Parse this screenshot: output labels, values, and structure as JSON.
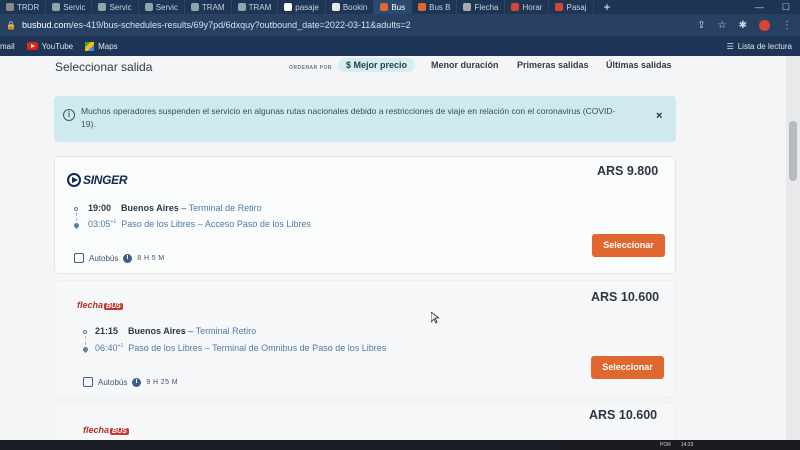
{
  "browser": {
    "tabs": [
      {
        "label": "TRDR",
        "color": "#888"
      },
      {
        "label": "Servic",
        "color": "#8aa"
      },
      {
        "label": "Servic",
        "color": "#8aa"
      },
      {
        "label": "Servic",
        "color": "#8aa"
      },
      {
        "label": "TRAM",
        "color": "#8aa"
      },
      {
        "label": "TRAM",
        "color": "#8aa"
      },
      {
        "label": "pasaje",
        "color": "#ffffff"
      },
      {
        "label": "Bookin",
        "color": "#e7e7e7"
      },
      {
        "label": "Bus",
        "color": "#e0672f"
      },
      {
        "label": "Bus B",
        "color": "#e0672f"
      },
      {
        "label": "Flecha",
        "color": "#aaa"
      },
      {
        "label": "Horar",
        "color": "#d64531"
      },
      {
        "label": "Pasaj",
        "color": "#d64531"
      }
    ],
    "url_host": "busbud.com",
    "url_path": "/es-419/bus-schedules-results/69y7pd/6dxquy?outbound_date=2022-03-11&adults=2",
    "bookmarks": {
      "mail": "mail",
      "youtube": "YouTube",
      "maps": "Maps",
      "reading_list": "Lista de lectura"
    }
  },
  "header": {
    "title": "Seleccionar salida",
    "sort_label": "ORDENAR POR",
    "sort_options": [
      "$ Mejor precio",
      "Menor duración",
      "Primeras salidas",
      "Últimas salidas"
    ]
  },
  "alert": {
    "message": "Muchos operadores suspenden el servicio en algunas rutas nacionales debido a restricciones de viaje en relación con el coronavirus (COVID-19).",
    "close": "×"
  },
  "results": [
    {
      "operator": "SINGER",
      "price": "ARS 9.800",
      "departure_time": "19:00",
      "departure_city": "Buenos Aires",
      "departure_terminal": "Terminal de Retiro",
      "arrival_time": "03:05",
      "arrival_sup": "+1",
      "arrival_city": "Paso de los Libres",
      "arrival_terminal": "Acceso Paso de los Libres",
      "vehicle": "Autobús",
      "duration": "8 H 5 M",
      "button": "Seleccionar"
    },
    {
      "operator": "flecha",
      "operator_badge": "BUS",
      "price": "ARS 10.600",
      "departure_time": "21:15",
      "departure_city": "Buenos Aires",
      "departure_terminal": "Terminal Retiro",
      "arrival_time": "06:40",
      "arrival_sup": "+1",
      "arrival_city": "Paso de los Libres",
      "arrival_terminal": "Terminal de Omnibus de Paso de los Libres",
      "vehicle": "Autobús",
      "duration": "9 H 25 M",
      "button": "Seleccionar"
    },
    {
      "operator": "flecha",
      "operator_badge": "BUS",
      "price": "ARS 10.600"
    }
  ],
  "taskbar": {
    "lang": "POR",
    "time": "14:33"
  }
}
